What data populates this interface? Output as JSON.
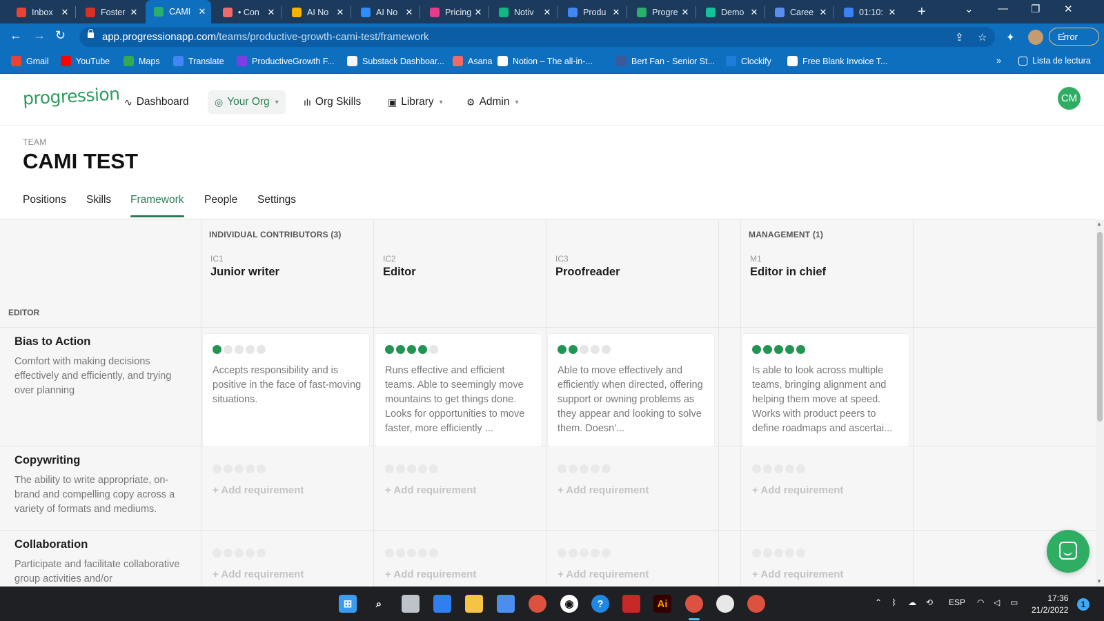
{
  "browser": {
    "tabs": [
      {
        "title": "Inbox",
        "color": "#ea4335"
      },
      {
        "title": "Foster",
        "color": "#d93025"
      },
      {
        "title": "CAMI",
        "color": "#28b06a",
        "active": true
      },
      {
        "title": "• Con",
        "color": "#f06a6a"
      },
      {
        "title": "AI No",
        "color": "#f4b400"
      },
      {
        "title": "AI No",
        "color": "#2d8cff"
      },
      {
        "title": "Pricing",
        "color": "#e33d8c"
      },
      {
        "title": "Notiv",
        "color": "#10b981"
      },
      {
        "title": "Produ",
        "color": "#4285f4"
      },
      {
        "title": "Progre",
        "color": "#28b06a"
      },
      {
        "title": "Demo",
        "color": "#15c39a"
      },
      {
        "title": "Caree",
        "color": "#5b8def"
      },
      {
        "title": "01:10:",
        "color": "#3b82f6"
      }
    ],
    "url_host": "app.progressionapp.com",
    "url_path": "/teams/productive-growth-cami-test/framework",
    "error_label": "Error",
    "bookmarks": [
      "Gmail",
      "YouTube",
      "Maps",
      "Translate",
      "ProductiveGrowth F...",
      "Substack Dashboar...",
      "Asana",
      "Notion – The all-in-...",
      "Bert Fan - Senior St...",
      "Clockify",
      "Free Blank Invoice T..."
    ],
    "bookmarks_more": "»",
    "reading_list": "Lista de lectura"
  },
  "app": {
    "logo": "progression",
    "nav": {
      "dashboard": "Dashboard",
      "your_org": "Your Org",
      "org_skills": "Org Skills",
      "library": "Library",
      "admin": "Admin"
    },
    "user_initials": "CM"
  },
  "team": {
    "eyebrow": "TEAM",
    "title": "CAMI TEST",
    "tabs": [
      "Positions",
      "Skills",
      "Framework",
      "People",
      "Settings"
    ],
    "active_tab": "Framework"
  },
  "framework": {
    "track_label": "EDITOR",
    "groups": {
      "ic": "INDIVIDUAL CONTRIBUTORS (3)",
      "mgmt": "MANAGEMENT (1)"
    },
    "columns": [
      {
        "code": "IC1",
        "title": "Junior writer"
      },
      {
        "code": "IC2",
        "title": "Editor"
      },
      {
        "code": "IC3",
        "title": "Proofreader"
      },
      {
        "code": "M1",
        "title": "Editor in chief"
      }
    ],
    "skills": [
      {
        "name": "Bias to Action",
        "description": "Comfort with making decisions effectively and efficiently, and trying over planning",
        "cells": [
          {
            "level": 1,
            "text": "Accepts responsibility and is positive in the face of fast-moving situations."
          },
          {
            "level": 4,
            "text": "Runs effective and efficient teams. Able to seemingly move mountains to get things done. Looks for opportunities to move faster, more efficiently ..."
          },
          {
            "level": 2,
            "text": "Able to move effectively and efficiently when directed, offering support or owning problems as they appear and looking to solve them. Doesn'..."
          },
          {
            "level": 5,
            "text": "Is able to look across multiple teams, bringing alignment and helping them move at speed. Works with product peers to define roadmaps and ascertai..."
          }
        ]
      },
      {
        "name": "Copywriting",
        "description": "The ability to write appropriate, on-brand and compelling copy across a variety of formats and mediums.",
        "cells": []
      },
      {
        "name": "Collaboration",
        "description": "Participate and facilitate collaborative group activities and/or",
        "cells": []
      }
    ],
    "add_requirement": "+ Add requirement",
    "max_level": 5
  },
  "taskbar": {
    "lang": "ESP",
    "time": "17:36",
    "date": "21/2/2022",
    "notifications": "1"
  }
}
